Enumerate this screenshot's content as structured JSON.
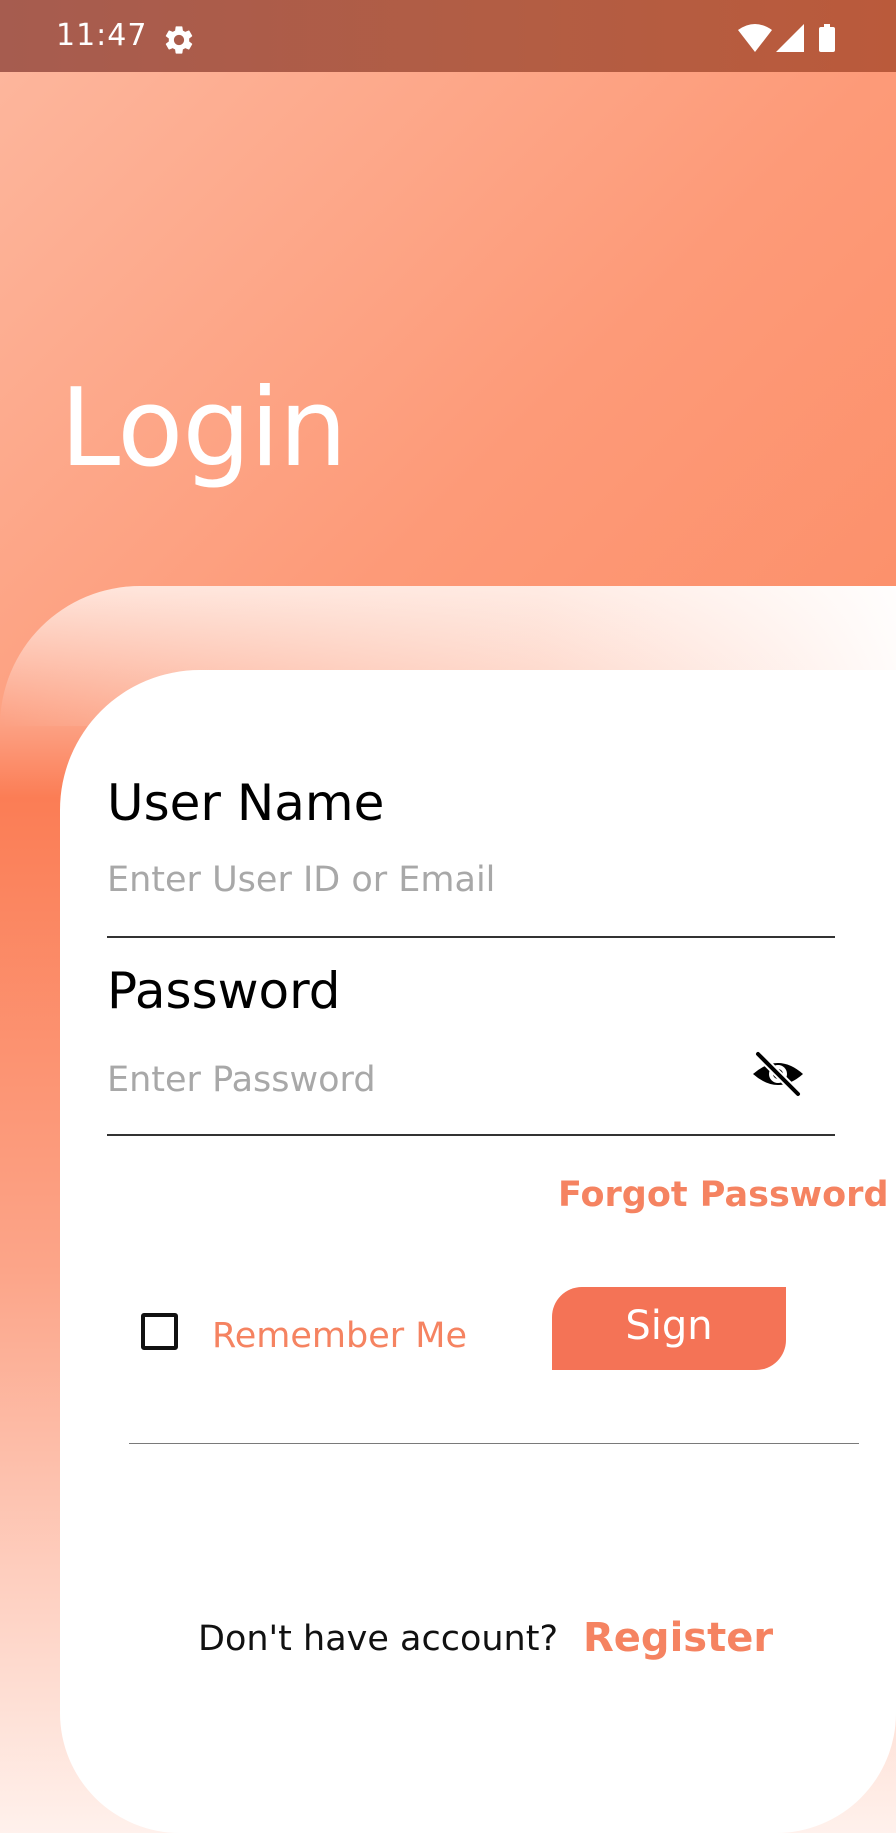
{
  "status_bar": {
    "time": "11:47",
    "icons": [
      "settings-gear-icon",
      "wifi-icon",
      "cell-signal-icon",
      "battery-icon"
    ]
  },
  "screen": {
    "title": "Login"
  },
  "form": {
    "username": {
      "label": "User Name",
      "placeholder": "Enter User ID or Email",
      "value": ""
    },
    "password": {
      "label": "Password",
      "placeholder": "Enter Password",
      "value": "",
      "visibility_icon": "eye-off-icon"
    },
    "forgot_label": "Forgot Password",
    "remember_label": "Remember Me",
    "remember_checked": false,
    "sign_label": "Sign"
  },
  "footer": {
    "prompt": "Don't have account?",
    "register_label": "Register"
  },
  "colors": {
    "accent": "#f58361",
    "button": "#f47356",
    "gradient_light": "#fdb89f",
    "gradient_dark": "#fb7b4f",
    "status_bar": "#b35d43"
  }
}
